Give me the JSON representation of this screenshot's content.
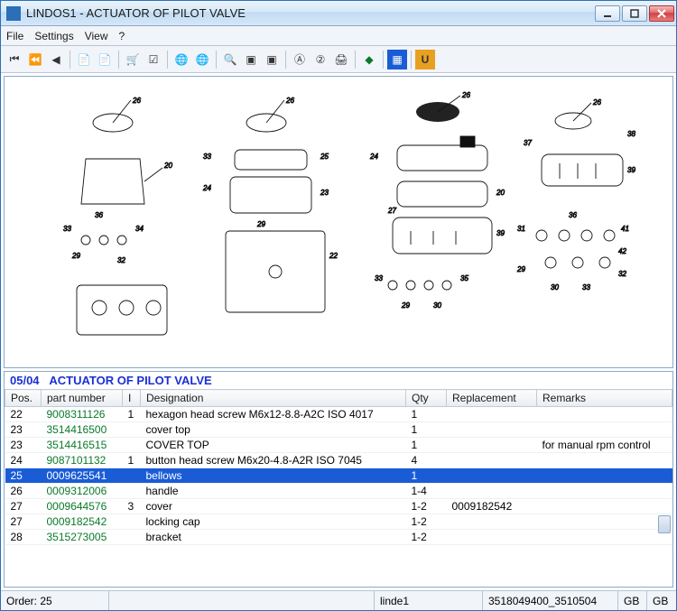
{
  "title": "LINDOS1 - ACTUATOR OF PILOT VALVE",
  "menus": [
    "File",
    "Settings",
    "View",
    "?"
  ],
  "section": {
    "code": "05/04",
    "name": "ACTUATOR OF PILOT VALVE"
  },
  "columns": [
    "Pos.",
    "part number",
    "I",
    "Designation",
    "Qty",
    "Replacement",
    "Remarks"
  ],
  "rows": [
    {
      "pos": "22",
      "pn": "9008311126",
      "i": "1",
      "des": "hexagon head screw M6x12-8.8-A2C  ISO 4017",
      "qty": "1",
      "rep": "",
      "rem": ""
    },
    {
      "pos": "23",
      "pn": "3514416500",
      "i": "",
      "des": "cover top",
      "qty": "1",
      "rep": "",
      "rem": ""
    },
    {
      "pos": "23",
      "pn": "3514416515",
      "i": "",
      "des": "COVER TOP",
      "qty": "1",
      "rep": "",
      "rem": "for manual rpm control"
    },
    {
      "pos": "24",
      "pn": "9087101132",
      "i": "1",
      "des": "button head screw M6x20-4.8-A2R  ISO 7045",
      "qty": "4",
      "rep": "",
      "rem": ""
    },
    {
      "pos": "25",
      "pn": "0009625541",
      "i": "",
      "des": "bellows",
      "qty": "1",
      "rep": "",
      "rem": "",
      "selected": true
    },
    {
      "pos": "26",
      "pn": "0009312006",
      "i": "",
      "des": "handle",
      "qty": "1-4",
      "rep": "",
      "rem": ""
    },
    {
      "pos": "27",
      "pn": "0009644576",
      "i": "3",
      "des": "cover",
      "qty": "1-2",
      "rep": "0009182542",
      "rem": ""
    },
    {
      "pos": "27",
      "pn": "0009182542",
      "i": "",
      "des": "locking cap",
      "qty": "1-2",
      "rep": "",
      "rem": ""
    },
    {
      "pos": "28",
      "pn": "3515273005",
      "i": "",
      "des": "bracket",
      "qty": "1-2",
      "rep": "",
      "rem": ""
    }
  ],
  "status": {
    "order": "Order: 25",
    "user": "linde1",
    "doc": "3518049400_3510504",
    "lang1": "GB",
    "lang2": "GB"
  }
}
